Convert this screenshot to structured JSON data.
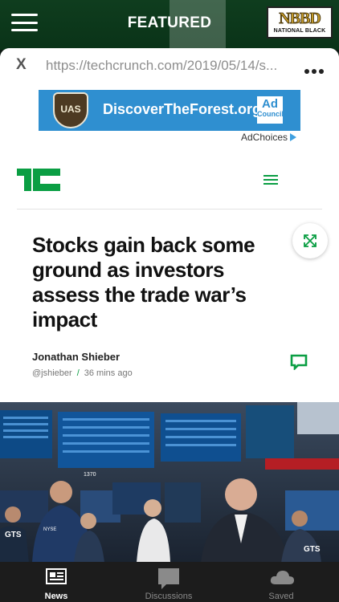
{
  "appbar": {
    "title": "FEATURED",
    "logo_letters": "NBBD",
    "logo_subtitle": "NATIONAL BLACK",
    "menu_icon": "hamburger-icon"
  },
  "browser": {
    "close_label": "X",
    "url": "https://techcrunch.com/2019/05/14/s...",
    "more_icon": "more-horizontal-icon"
  },
  "ad": {
    "shield_text": "UAS",
    "text": "DiscoverTheForest.org",
    "council_top": "Ad",
    "council_bottom": "Council",
    "adchoices": "AdChoices"
  },
  "site": {
    "logo": "techcrunch-logo",
    "menu_icon": "menu-icon"
  },
  "article": {
    "headline": "Stocks gain back some ground as investors assess the trade war’s impact",
    "author": "Jonathan Shieber",
    "handle": "@jshieber",
    "separator": "/",
    "time": "36 mins ago",
    "share_icon": "share-icon",
    "comment_icon": "comment-icon"
  },
  "photo": {
    "ticker_labels": [
      "GTS",
      "GTS",
      "1370",
      "NYSE"
    ]
  },
  "bottom_nav": {
    "items": [
      {
        "label": "News",
        "icon": "newspaper-icon",
        "active": true
      },
      {
        "label": "Discussions",
        "icon": "chat-bubble-icon",
        "active": false
      },
      {
        "label": "Saved",
        "icon": "cloud-icon",
        "active": false
      }
    ]
  },
  "colors": {
    "appbar": "#0f3d1e",
    "tc_green": "#0a9e43",
    "ad_blue": "#2f8fd0",
    "nav_bg": "#1c1c1c"
  }
}
